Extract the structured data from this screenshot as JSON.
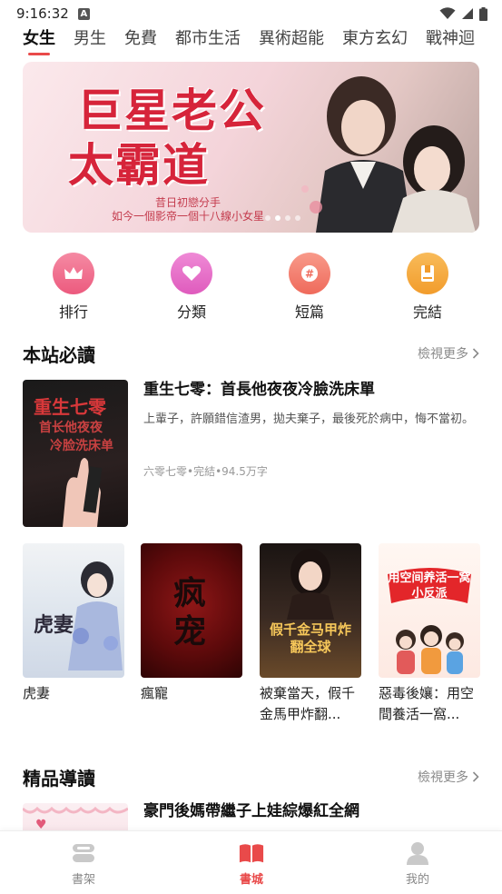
{
  "status_bar": {
    "time": "9:16:32",
    "notification_icon": "a-badge-icon"
  },
  "categories": [
    {
      "label": "女生",
      "active": true
    },
    {
      "label": "男生"
    },
    {
      "label": "免費"
    },
    {
      "label": "都市生活"
    },
    {
      "label": "異術超能"
    },
    {
      "label": "東方玄幻"
    },
    {
      "label": "戰神迴"
    }
  ],
  "banner": {
    "title_line1": "巨星老公",
    "title_line2": "太霸道",
    "subtitle_line1": "昔日初戀分手",
    "subtitle_line2": "如今一個影帝一個十八線小女星",
    "slide_count": 4,
    "active_slide": 1
  },
  "quick_entries": [
    {
      "label": "排行",
      "icon": "crown-icon",
      "color": "#f06b8a"
    },
    {
      "label": "分類",
      "icon": "heart-icon",
      "color": "#e86fc6"
    },
    {
      "label": "短篇",
      "icon": "hashtag-icon",
      "color": "#f27a6a"
    },
    {
      "label": "完結",
      "icon": "book-icon",
      "color": "#f5a23a"
    }
  ],
  "section_must_read": {
    "title": "本站必讀",
    "more": "檢視更多",
    "featured": {
      "title": "重生七零：首長他夜夜冷臉洗床單",
      "description": "上輩子，許願錯信渣男，拋夫棄子，最後死於病中，悔不當初。",
      "meta": "六零七零•完結•94.5万字",
      "cover_text_1": "重生七零",
      "cover_text_2": "首长他夜夜",
      "cover_text_3": "冷脸洗床单"
    },
    "grid": [
      {
        "title": "虎妻",
        "cover_text": "虎妻"
      },
      {
        "title": "瘋寵",
        "cover_text": "疯宠"
      },
      {
        "title": "被棄當天，假千金馬甲炸翻...",
        "cover_text": "假千金马甲炸翻全球"
      },
      {
        "title": "惡毒後孃：用空間養活一窩...",
        "cover_text": "用空间养活一窝小反派"
      }
    ]
  },
  "section_guide": {
    "title": "精品導讀",
    "more": "檢視更多",
    "first_book_title": "豪門後媽帶繼子上娃綜爆紅全網"
  },
  "bottom_nav": [
    {
      "label": "書架",
      "icon": "bookshelf-icon",
      "active": false
    },
    {
      "label": "書城",
      "icon": "open-book-icon",
      "active": true
    },
    {
      "label": "我的",
      "icon": "profile-icon",
      "active": false
    }
  ],
  "colors": {
    "accent": "#e94a4a",
    "banner_title": "#d6243a"
  }
}
